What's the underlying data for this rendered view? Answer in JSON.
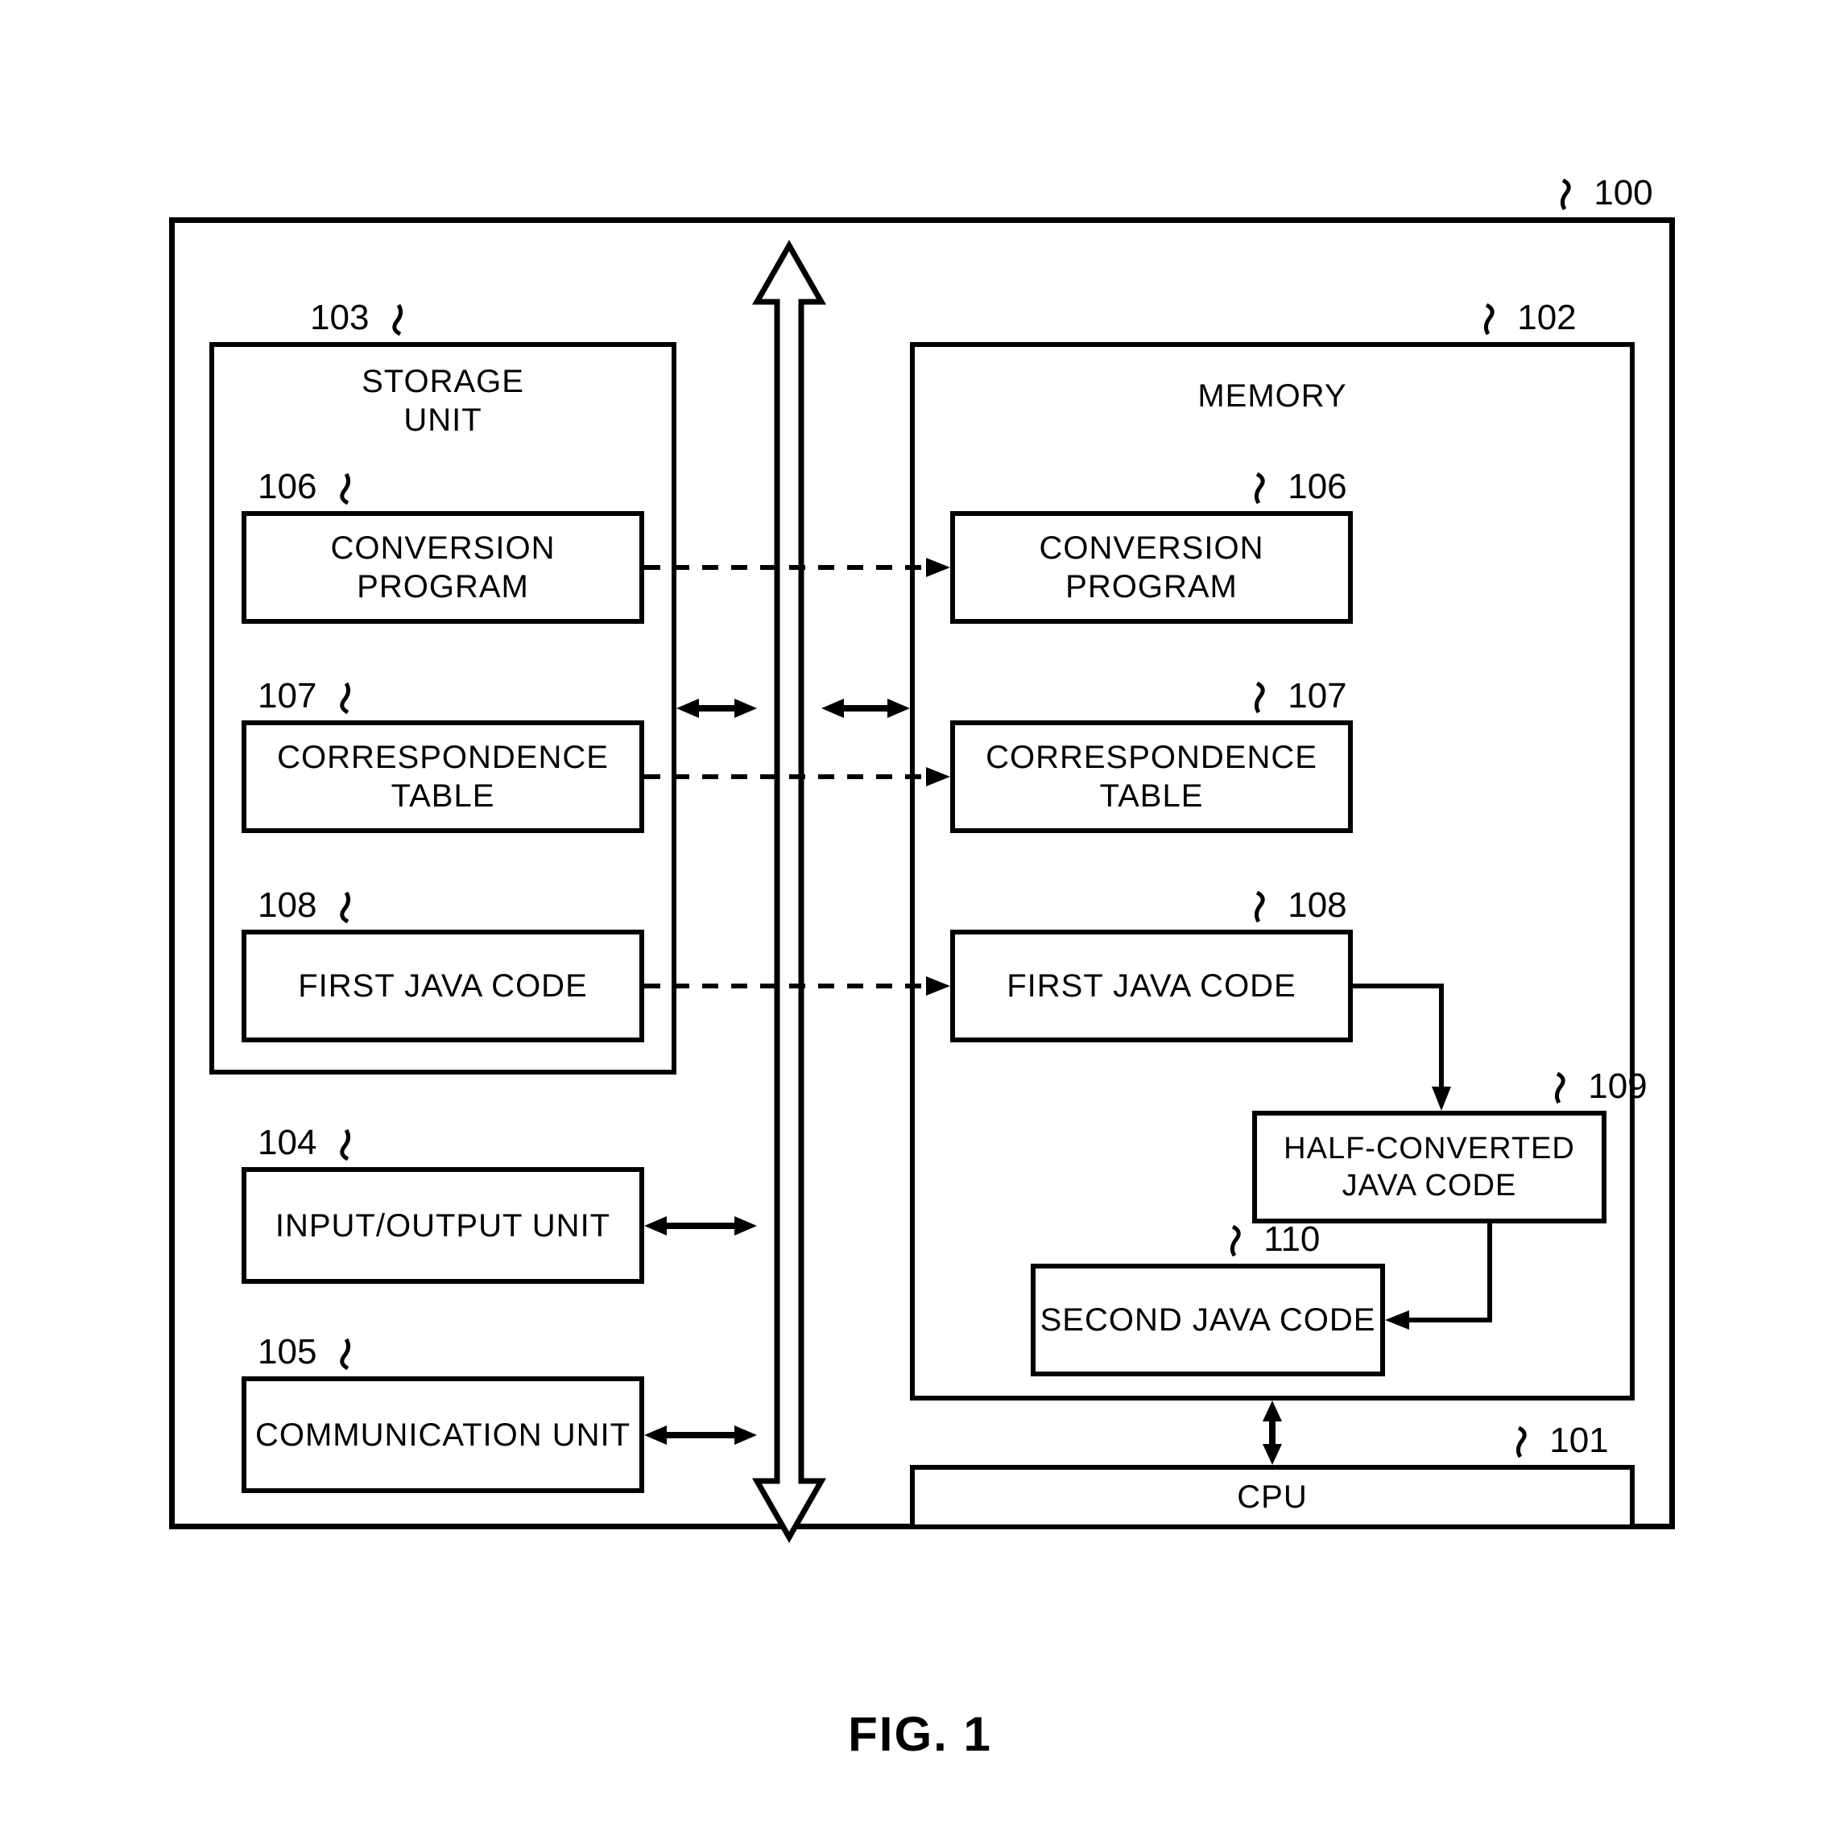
{
  "figure_label": "FIG. 1",
  "refs": {
    "system": "100",
    "cpu": "101",
    "memory": "102",
    "storage": "103",
    "io": "104",
    "comm": "105",
    "conv_prog": "106",
    "corr_table": "107",
    "first_java": "108",
    "half_conv": "109",
    "second_java": "110"
  },
  "labels": {
    "storage_title": "STORAGE\nUNIT",
    "memory_title": "MEMORY",
    "conv_prog": "CONVERSION\nPROGRAM",
    "corr_table": "CORRESPONDENCE\nTABLE",
    "first_java": "FIRST\nJAVA CODE",
    "half_conv": "HALF-CONVERTED\nJAVA CODE",
    "second_java": "SECOND\nJAVA CODE",
    "io": "INPUT/OUTPUT\nUNIT",
    "comm": "COMMUNICATION\nUNIT",
    "cpu": "CPU"
  }
}
